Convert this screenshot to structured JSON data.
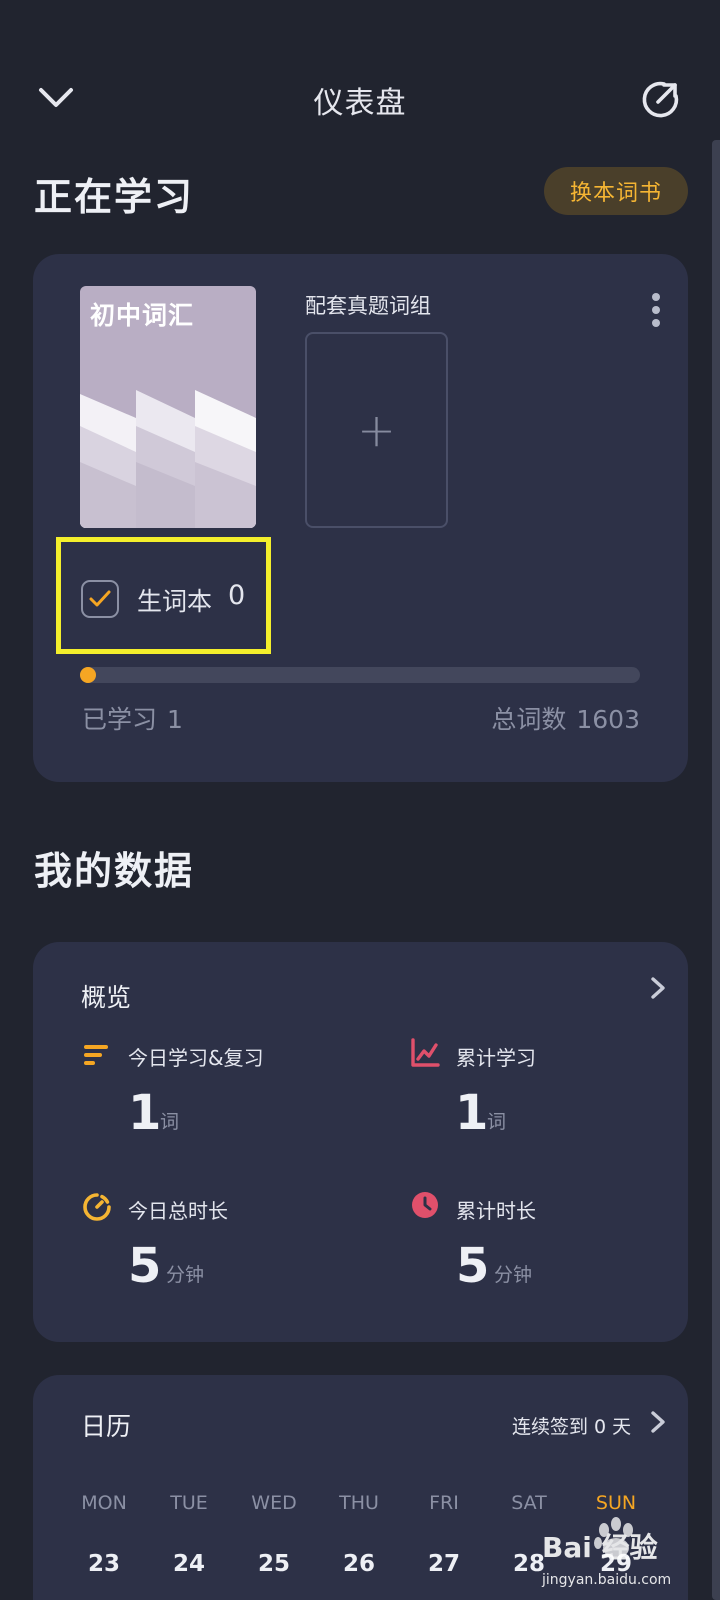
{
  "header": {
    "title": "仪表盘",
    "back_icon": "chevron-down-icon",
    "share_icon": "external-link-icon"
  },
  "studying": {
    "section_title": "正在学习",
    "switch_book_label": "换本词书",
    "book_cover_title": "初中词汇",
    "pack_label": "配套真题词组",
    "add_label": "+",
    "vocab_notebook_label": "生词本",
    "vocab_notebook_count": "0",
    "learned_label": "已学习",
    "learned_count": "1",
    "total_label": "总词数",
    "total_count": "1603",
    "progress_fraction": 0.0006,
    "accent_color": "#f5a623"
  },
  "my_data": {
    "section_title": "我的数据",
    "overview": {
      "title": "概览",
      "stats": [
        {
          "label": "今日学习&复习",
          "value": "1",
          "unit": "词",
          "icon": "list-bars-icon",
          "color": "#f5a623"
        },
        {
          "label": "累计学习",
          "value": "1",
          "unit": "词",
          "icon": "line-chart-icon",
          "color": "#e0506b"
        },
        {
          "label": "今日总时长",
          "value": "5",
          "unit": "分钟",
          "icon": "timer-icon",
          "color": "#f5b533"
        },
        {
          "label": "累计时长",
          "value": "5",
          "unit": "分钟",
          "icon": "clock-icon",
          "color": "#e0506b"
        }
      ]
    },
    "calendar": {
      "title": "日历",
      "streak_label": "连续签到 0 天",
      "days": [
        "MON",
        "TUE",
        "WED",
        "THU",
        "FRI",
        "SAT",
        "SUN"
      ],
      "dates": [
        "23",
        "24",
        "25",
        "26",
        "27",
        "28",
        "29"
      ]
    }
  },
  "watermark": {
    "brand_text": "Bai 经验",
    "url": "jingyan.baidu.com"
  }
}
